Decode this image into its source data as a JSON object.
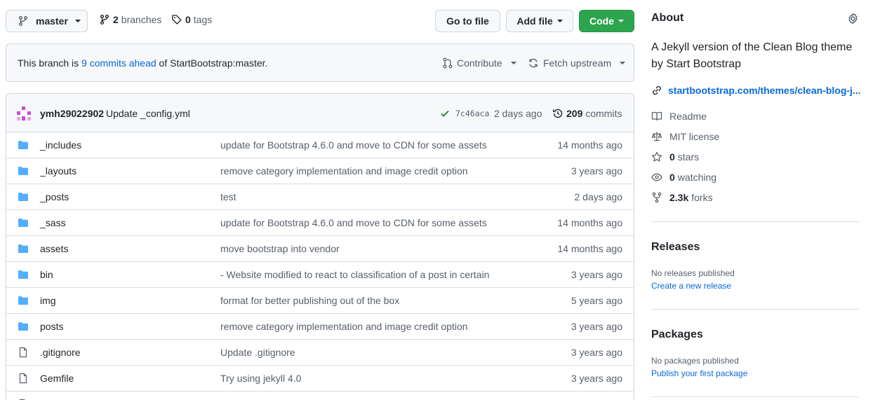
{
  "top": {
    "branch": "master",
    "branches_count": "2",
    "branches_label": "branches",
    "tags_count": "0",
    "tags_label": "tags",
    "go_to_file": "Go to file",
    "add_file": "Add file",
    "code": "Code"
  },
  "banner": {
    "prefix": "This branch is",
    "link": "9 commits ahead",
    "suffix": "of StartBootstrap:master.",
    "contribute": "Contribute",
    "fetch": "Fetch upstream"
  },
  "commit": {
    "author": "ymh29022902",
    "message": "Update _config.yml",
    "sha": "7c46aca",
    "time": "2 days ago",
    "count": "209",
    "count_label": "commits"
  },
  "files": [
    {
      "type": "dir",
      "name": "_includes",
      "message": "update for Bootstrap 4.6.0 and move to CDN for some assets",
      "age": "14 months ago"
    },
    {
      "type": "dir",
      "name": "_layouts",
      "message": "remove category implementation and image credit option",
      "age": "3 years ago"
    },
    {
      "type": "dir",
      "name": "_posts",
      "message": "test",
      "age": "2 days ago"
    },
    {
      "type": "dir",
      "name": "_sass",
      "message": "update for Bootstrap 4.6.0 and move to CDN for some assets",
      "age": "14 months ago"
    },
    {
      "type": "dir",
      "name": "assets",
      "message": "move bootstrap into vendor",
      "age": "14 months ago"
    },
    {
      "type": "dir",
      "name": "bin",
      "message": "- Website modified to react to classification of a post in certain",
      "age": "3 years ago"
    },
    {
      "type": "dir",
      "name": "img",
      "message": "format for better publishing out of the box",
      "age": "5 years ago"
    },
    {
      "type": "dir",
      "name": "posts",
      "message": "remove category implementation and image credit option",
      "age": "3 years ago"
    },
    {
      "type": "file",
      "name": ".gitignore",
      "message": "Update .gitignore",
      "age": "3 years ago"
    },
    {
      "type": "file",
      "name": "Gemfile",
      "message": "Try using jekyll 4.0",
      "age": "3 years ago"
    }
  ],
  "about": {
    "title": "About",
    "description": "A Jekyll version of the Clean Blog theme by Start Bootstrap",
    "link": "startbootstrap.com/themes/clean-blog-j...",
    "readme": "Readme",
    "license": "MIT license",
    "stars_count": "0",
    "stars_label": "stars",
    "watching_count": "0",
    "watching_label": "watching",
    "forks_count": "2.3k",
    "forks_label": "forks"
  },
  "releases": {
    "title": "Releases",
    "none": "No releases published",
    "create": "Create a new release"
  },
  "packages": {
    "title": "Packages",
    "none": "No packages published",
    "publish": "Publish your first package"
  },
  "colors": {
    "accent_link": "#0969da",
    "code_button": "#2da44e",
    "folder": "#54aeff",
    "check": "#1a7f37"
  }
}
